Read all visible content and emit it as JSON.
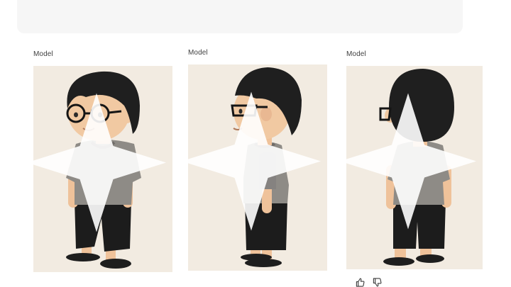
{
  "prompt": {
    "text": ""
  },
  "panels": [
    {
      "label": "Model",
      "view": "three-quarter front view"
    },
    {
      "label": "Model",
      "view": "side view"
    },
    {
      "label": "Model",
      "view": "back view"
    }
  ],
  "feedback": {
    "like_icon": "thumbs-up-icon",
    "dislike_icon": "thumbs-down-icon"
  },
  "colors": {
    "card_background": "#f2ebe1",
    "hair": "#1f1f1f",
    "skin": "#f1c9a2",
    "shirt": "#8e8b86",
    "pants": "#1d1d1d"
  }
}
